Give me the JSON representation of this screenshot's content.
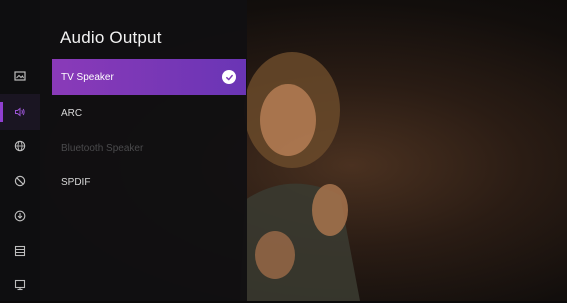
{
  "panel": {
    "title": "Audio Output",
    "options": [
      {
        "label": "TV Speaker",
        "state": "selected"
      },
      {
        "label": "ARC",
        "state": "normal"
      },
      {
        "label": "Bluetooth Speaker",
        "state": "disabled"
      },
      {
        "label": "SPDIF",
        "state": "normal"
      }
    ]
  },
  "rail": {
    "items": [
      {
        "icon": "picture-icon"
      },
      {
        "icon": "sound-icon",
        "active": true
      },
      {
        "icon": "globe-icon"
      },
      {
        "icon": "no-sign-icon"
      },
      {
        "icon": "download-icon"
      },
      {
        "icon": "list-icon"
      },
      {
        "icon": "tv-support-icon"
      }
    ]
  },
  "colors": {
    "selected_start": "#8a3ab8",
    "selected_end": "#6a35b5",
    "active_indicator": "#8f3fd0",
    "panel_bg": "#111012"
  }
}
